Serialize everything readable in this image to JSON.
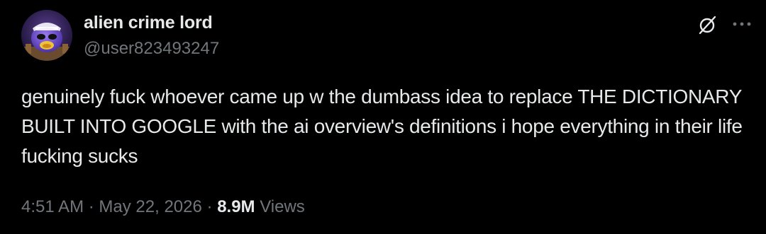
{
  "author": {
    "display_name": "alien crime lord",
    "handle": "@user823493247",
    "avatar_icon": "alien-avatar"
  },
  "tweet": {
    "text": "genuinely fuck whoever came up w the dumbass idea to replace THE DICTIONARY BUILT INTO GOOGLE with the ai overview's definitions i hope everything in their life fucking sucks"
  },
  "meta": {
    "time": "4:51 AM",
    "separator": "·",
    "date": "May 22, 2026",
    "views_count": "8.9M",
    "views_label": "Views"
  },
  "icons": {
    "grok": "grok-icon",
    "more": "more-options-icon"
  },
  "colors": {
    "background": "#000000",
    "primary_text": "#e7e9ea",
    "secondary_text": "#71767b"
  }
}
